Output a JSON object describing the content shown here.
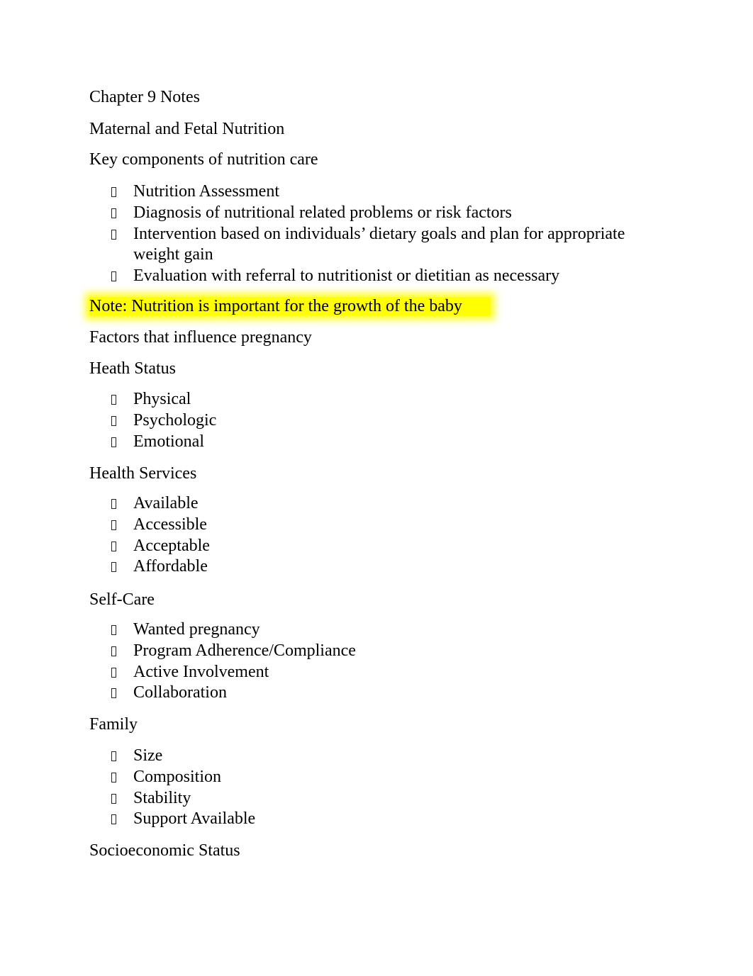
{
  "document": {
    "title": "Chapter 9 Notes",
    "subtitle": "Maternal and Fetal Nutrition",
    "section_key_components": {
      "heading": "Key components of nutrition care",
      "items": [
        "Nutrition Assessment",
        "Diagnosis of nutritional related problems or risk factors",
        "Intervention based on individuals’ dietary goals and plan for appropriate",
        "weight gain",
        "Evaluation with referral to nutritionist or dietitian as necessary"
      ]
    },
    "note": "Note: Nutrition is important for the growth of the baby",
    "highlight_color": "#ffff00",
    "factors_heading": "Factors that influence pregnancy",
    "health_status": {
      "heading": "Heath Status",
      "items": [
        "Physical",
        "Psychologic",
        "Emotional"
      ]
    },
    "health_services": {
      "heading": "Health Services",
      "items": [
        "Available",
        "Accessible",
        "Acceptable",
        "Affordable"
      ]
    },
    "self_care": {
      "heading": "Self-Care",
      "items": [
        "Wanted pregnancy",
        "Program Adherence/Compliance",
        "Active Involvement",
        "Collaboration"
      ]
    },
    "family": {
      "heading": "Family",
      "items": [
        "Size",
        "Composition",
        "Stability",
        "Support Available"
      ]
    },
    "socioeconomic_heading": "Socioeconomic Status",
    "bullet_icon": "missing-glyph-box"
  }
}
